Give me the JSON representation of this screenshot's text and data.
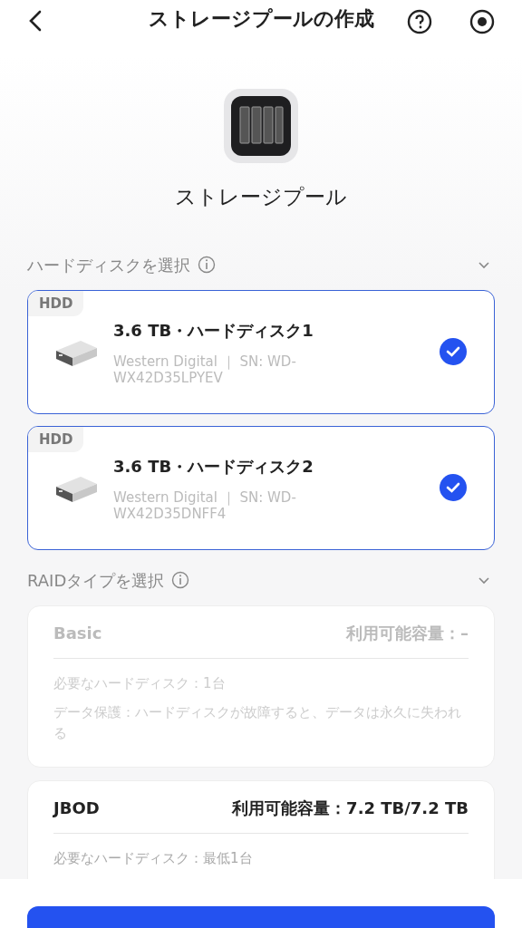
{
  "header": {
    "title": "ストレージプールの作成"
  },
  "pool": {
    "name": "ストレージプール"
  },
  "disk_section": {
    "title": "ハードディスクを選択",
    "expanded": true
  },
  "disks": [
    {
      "tag": "HDD",
      "title": "3.6 TB・ハードディスク1",
      "detail": "Western Digital ｜ SN: WD-WX42D35LPYEV",
      "selected": true
    },
    {
      "tag": "HDD",
      "title": "3.6 TB・ハードディスク2",
      "detail": "Western Digital ｜ SN: WD-WX42D35DNFF4",
      "selected": true
    }
  ],
  "raid_section": {
    "title": "RAIDタイプを選択",
    "expanded": true
  },
  "raid_types": [
    {
      "name": "Basic",
      "capacity": "利用可能容量：–",
      "disabled": true,
      "lines": [
        "必要なハードディスク：1台",
        "データ保護：ハードディスクが故障すると、データは永久に失われる"
      ]
    },
    {
      "name": "JBOD",
      "capacity": "利用可能容量：7.2 TB/7.2 TB",
      "disabled": false,
      "lines": [
        "必要なハードディスク：最低1台"
      ]
    }
  ]
}
